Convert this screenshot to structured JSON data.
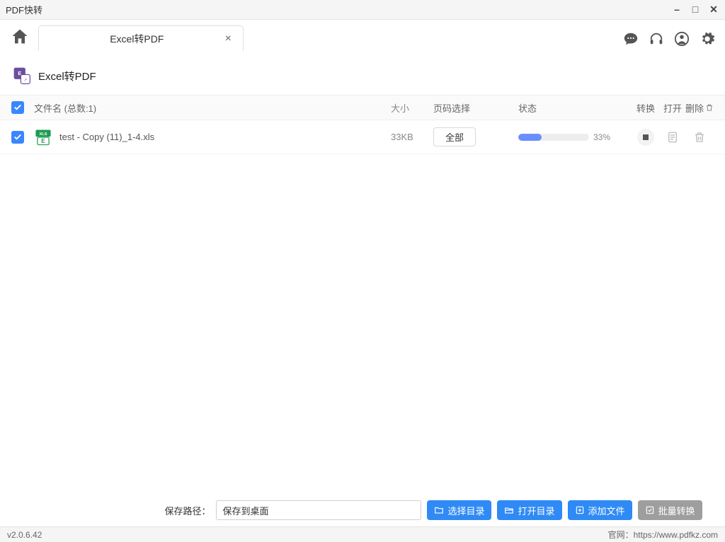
{
  "window": {
    "title": "PDF快转"
  },
  "tab": {
    "label": "Excel转PDF"
  },
  "section": {
    "title": "Excel转PDF"
  },
  "header": {
    "filename": "文件名 (总数:1)",
    "size": "大小",
    "pages": "页码选择",
    "status": "状态",
    "convert": "转换",
    "open": "打开",
    "delete": "删除"
  },
  "file": {
    "name": "test - Copy (11)_1-4.xls",
    "size": "33KB",
    "page_select": "全部",
    "progress_pct": "33%",
    "progress_width": "33%"
  },
  "bottom": {
    "path_label": "保存路径：",
    "path_value": "保存到桌面",
    "choose_dir": "选择目录",
    "open_dir": "打开目录",
    "add_file": "添加文件",
    "batch_convert": "批量转换"
  },
  "status": {
    "version": "v2.0.6.42",
    "site_label": "官网：",
    "site_url": "https://www.pdfkz.com"
  },
  "icons": {
    "home": "home-icon",
    "chat": "chat-icon",
    "headset": "headset-icon",
    "user": "user-icon",
    "gear": "gear-icon"
  }
}
